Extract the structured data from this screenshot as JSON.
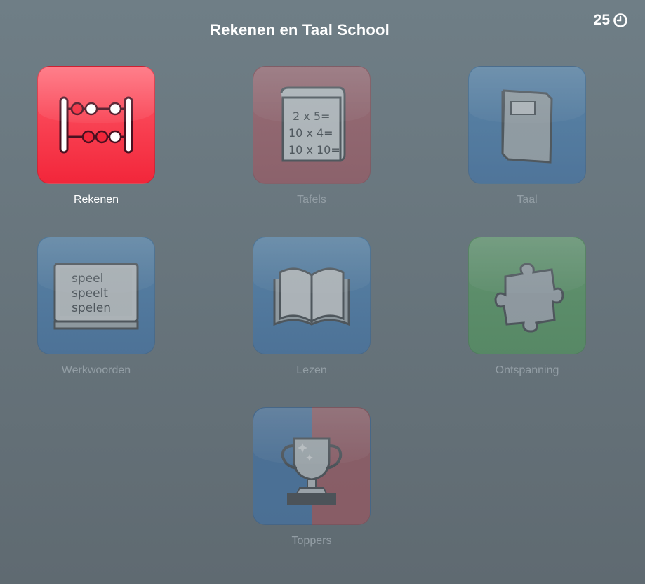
{
  "header": {
    "title": "Rekenen en Taal School",
    "timer": "25",
    "timer_icon": "clock-icon"
  },
  "tiles": [
    {
      "label": "Rekenen",
      "icon": "abacus-icon",
      "color": "#f2263a"
    },
    {
      "label": "Tafels",
      "icon": "times-table-scroll-icon",
      "lines": [
        "2 x  5=",
        "10 x  4=",
        "10 x 10="
      ]
    },
    {
      "label": "Taal",
      "icon": "book-icon"
    },
    {
      "label": "Werkwoorden",
      "icon": "chalkboard-icon",
      "lines": [
        "speel",
        "speelt",
        "spelen"
      ]
    },
    {
      "label": "Lezen",
      "icon": "open-book-icon"
    },
    {
      "label": "Ontspanning",
      "icon": "puzzle-piece-icon"
    },
    {
      "label": "Toppers",
      "icon": "trophy-icon"
    }
  ]
}
